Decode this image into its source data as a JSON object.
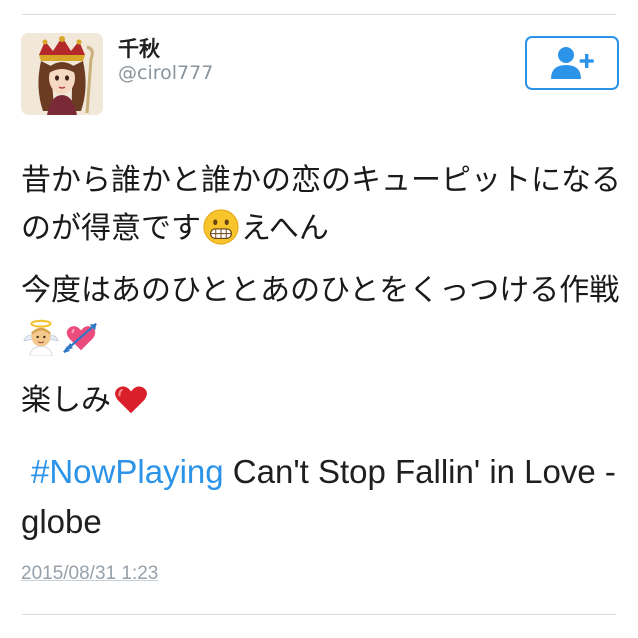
{
  "user": {
    "display_name": "千秋",
    "handle": "@cirol777"
  },
  "follow_button": {
    "icon": "add-user-icon",
    "accent": "#2b93e8"
  },
  "tweet": {
    "line1": "昔から誰かと誰かの恋のキューピットになるのが得意です",
    "line1_emoji": "grimacing-face-emoji",
    "line1_tail": "えへん",
    "line2": "今度はあのひととあのひとをくっつける作戦",
    "line2_emoji_a": "angel-emoji",
    "line2_emoji_b": "heart-with-arrow-emoji",
    "line3": "楽しみ",
    "line3_emoji": "red-heart-emoji",
    "hashtag": "#NowPlaying",
    "nowplaying_text": " Can't Stop Fallin' in Love - globe",
    "timestamp": "2015/08/31 1:23"
  }
}
